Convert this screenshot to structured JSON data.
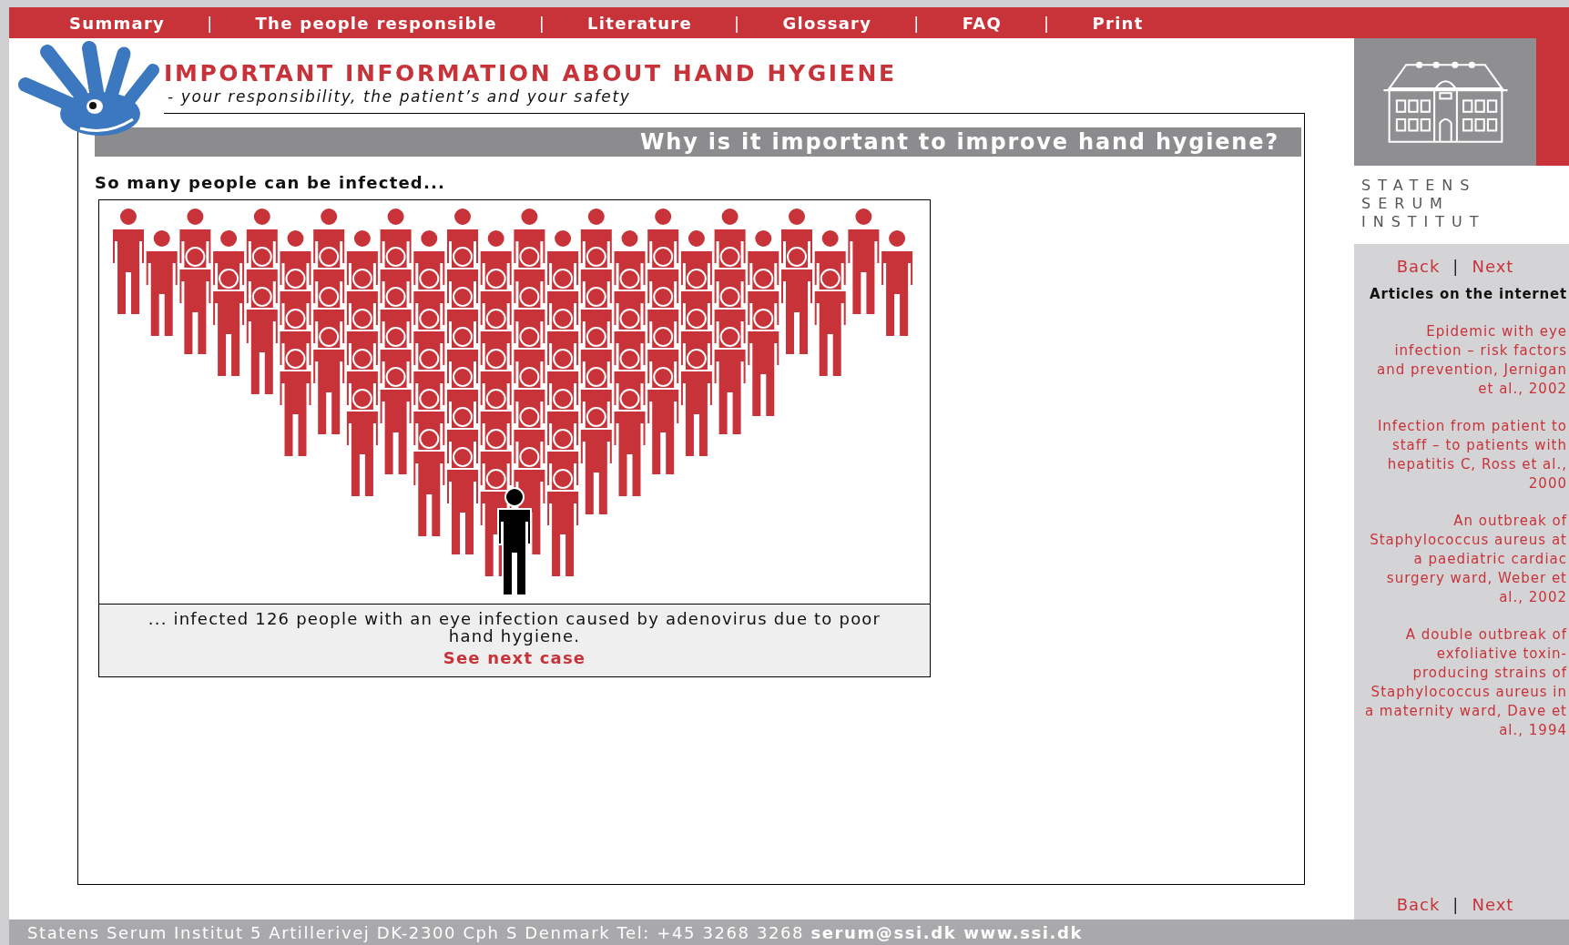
{
  "nav": [
    {
      "kind": "link",
      "label": "Summary"
    },
    {
      "kind": "separator",
      "label": "|"
    },
    {
      "kind": "link",
      "label": "The people responsible"
    },
    {
      "kind": "separator",
      "label": "|"
    },
    {
      "kind": "link",
      "label": "Literature"
    },
    {
      "kind": "separator",
      "label": "|"
    },
    {
      "kind": "link",
      "label": "Glossary"
    },
    {
      "kind": "separator",
      "label": "|"
    },
    {
      "kind": "link",
      "label": "FAQ"
    },
    {
      "kind": "separator",
      "label": "|"
    },
    {
      "kind": "link",
      "label": "Print"
    }
  ],
  "header": {
    "title": "IMPORTANT INFORMATION ABOUT HAND HYGIENE",
    "subtitle": "- your responsibility, the patient’s and your safety"
  },
  "section": {
    "heading": "Why is it important to improve hand hygiene?",
    "intro": "So many people can be infected...",
    "figure": {
      "caption": "... infected 126 people with an eye infection caused by adenovirus due to poor hand hygiene.",
      "link": "See next case"
    }
  },
  "brand": {
    "lines": [
      "STATENS",
      "SERUM",
      "INSTITUT"
    ]
  },
  "sidebar": {
    "top_nav": [
      {
        "kind": "link",
        "label": "Back"
      },
      {
        "kind": "separator",
        "label": "|"
      },
      {
        "kind": "link",
        "label": "Next"
      }
    ],
    "heading": "Articles on the internet",
    "articles": [
      "Epidemic with eye infection – risk factors and prevention, Jernigan et al., 2002",
      "Infection from patient to staff – to patients with hepatitis C, Ross et al., 2000",
      "An outbreak of Staphylococcus aureus at a paediatric cardiac surgery ward, Weber et al., 2002",
      "A double outbreak of exfoliative toxin-producing strains of Staphylococcus aureus in a maternity ward, Dave et al., 1994"
    ],
    "bottom_nav": [
      {
        "kind": "link",
        "label": "Back"
      },
      {
        "kind": "separator",
        "label": "|"
      },
      {
        "kind": "link",
        "label": "Next"
      }
    ]
  },
  "footer": {
    "text": "Statens Serum Institut 5 Artillerivej DK-2300 Cph S Denmark Tel: +45 3268 3268 **serum@ssi.dk www.ssi.dk**"
  }
}
